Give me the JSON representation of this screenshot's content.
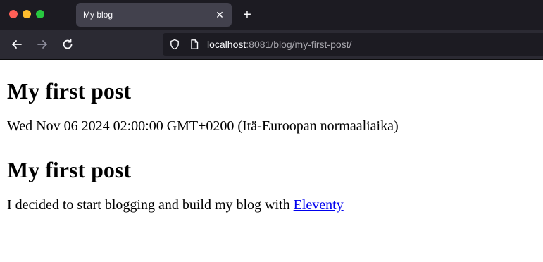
{
  "browser": {
    "tab_title": "My blog",
    "tab_close_glyph": "✕",
    "new_tab_glyph": "+",
    "url_host": "localhost",
    "url_path": ":8081/blog/my-first-post/",
    "icons": [
      "back-icon",
      "forward-icon",
      "reload-icon",
      "shield-icon",
      "page-icon",
      "close-icon",
      "plus-icon"
    ]
  },
  "page": {
    "title": "My first post",
    "date": "Wed Nov 06 2024 02:00:00 GMT+0200 (Itä-Euroopan normaaliaika)",
    "content_heading": "My first post",
    "body_text": "I decided to start blogging and build my blog with ",
    "link_text": "Eleventy"
  },
  "colors": {
    "chrome_bg": "#1c1b22",
    "tab_bg": "#42414d",
    "link": "#0000ee"
  }
}
